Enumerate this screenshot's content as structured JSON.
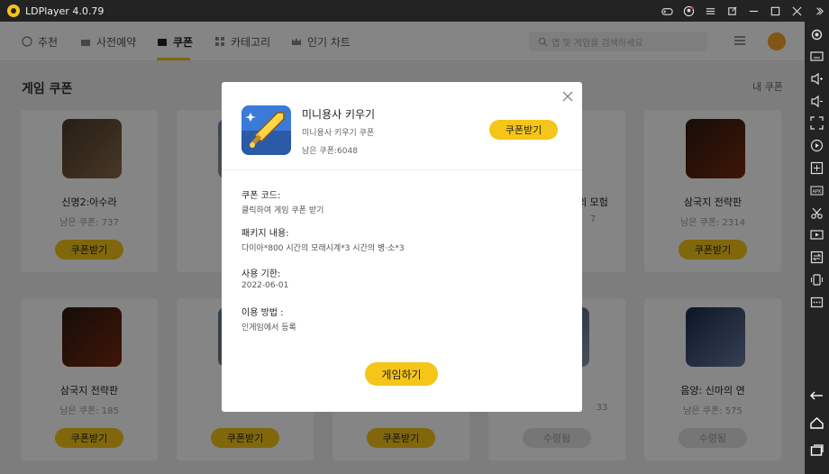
{
  "window": {
    "title": "LDPlayer 4.0.79"
  },
  "nav": {
    "items": [
      {
        "label": "추천"
      },
      {
        "label": "사전예약"
      },
      {
        "label": "쿠폰"
      },
      {
        "label": "카테고리"
      },
      {
        "label": "인기 차트"
      }
    ],
    "search_placeholder": "앱 및 게임을 검색하세요"
  },
  "page": {
    "title": "게임 쿠폰",
    "my_coupon": "내 쿠폰"
  },
  "cards": [
    {
      "name": "신명2:아수라",
      "remain": "남은 쿠폰: 737",
      "button": "쿠폰받기",
      "status": "available"
    },
    {
      "name": "삼국지 전략판",
      "remain": "남은 쿠폰: 2314",
      "button": "쿠폰받기",
      "status": "available"
    },
    {
      "name": "삼국지 전략판",
      "remain": "남은 쿠폰: 185",
      "button": "쿠폰받기",
      "status": "available"
    },
    {
      "name": "음양: 신마의 연",
      "remain": "남은 쿠폰: 575",
      "button": "수령됨",
      "status": "claimed"
    }
  ],
  "partial_cards": [
    {
      "name_fragment": "의 모험",
      "remain_fragment": "7"
    },
    {
      "name_fragment": "",
      "remain_fragment": "33",
      "button": "수령됨"
    }
  ],
  "modal": {
    "game_name": "미니용사 키우기",
    "coupon_title": "미니용사 키우기 쿠폰",
    "remaining": "남은 쿠폰:6048",
    "claim_button": "쿠폰받기",
    "fields": [
      {
        "label": "쿠폰 코드:",
        "value": "클릭하여 게임 쿠폰 받기"
      },
      {
        "label": "패키지 내용:",
        "value": "다이아*800 시간의 모래시계*3 시간의 병·소*3"
      },
      {
        "label": "사용 기한:",
        "value": "2022-06-01"
      },
      {
        "label": "이용 방법 :",
        "value": "인게임에서 등록"
      }
    ],
    "play_button": "게임하기"
  },
  "colors": {
    "accent": "#f5c518",
    "titlebar": "#232323",
    "overlay": "rgba(0,0,0,0.48)"
  }
}
